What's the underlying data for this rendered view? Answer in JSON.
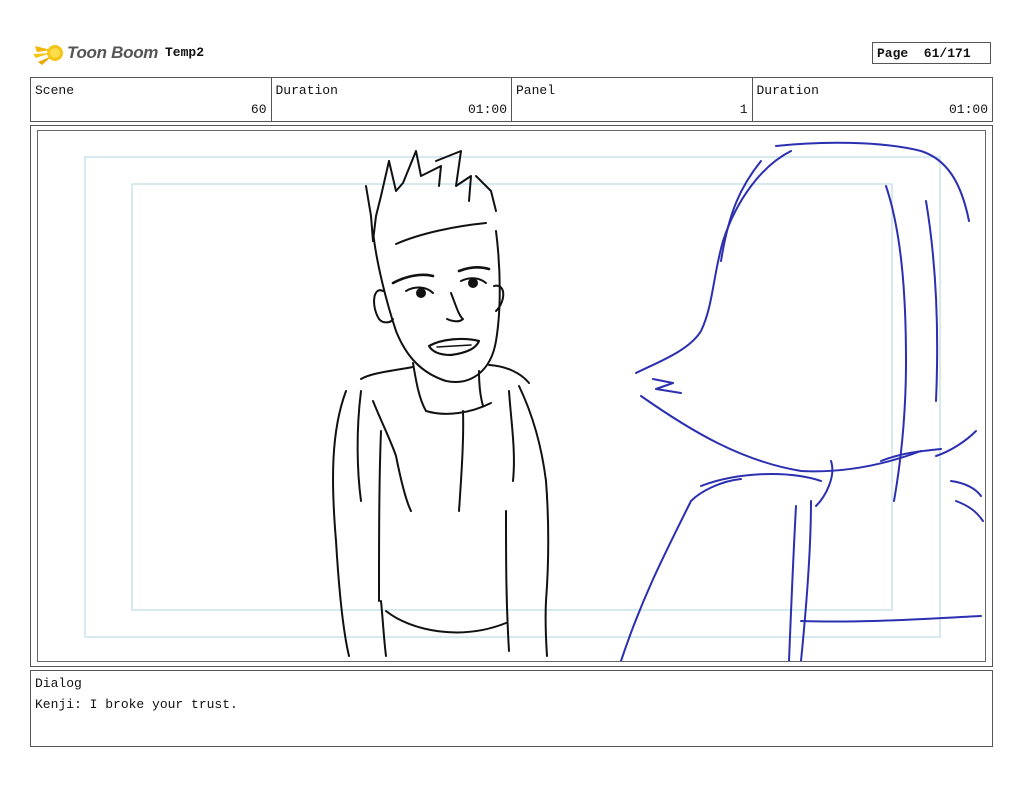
{
  "header": {
    "logo_text": "Toon Boom",
    "project": "Temp2",
    "page": "Page  61/171"
  },
  "info": {
    "scene_label": "Scene",
    "scene_value": "60",
    "scene_duration_label": "Duration",
    "scene_duration_value": "01:00",
    "panel_label": "Panel",
    "panel_value": "1",
    "panel_duration_label": "Duration",
    "panel_duration_value": "01:00"
  },
  "dialog": {
    "label": "Dialog",
    "text": "Kenji: I broke your trust."
  },
  "colors": {
    "safe_frame": "#bcdde6",
    "character_line": "#111111",
    "foreground_line": "#2b2fb0"
  }
}
